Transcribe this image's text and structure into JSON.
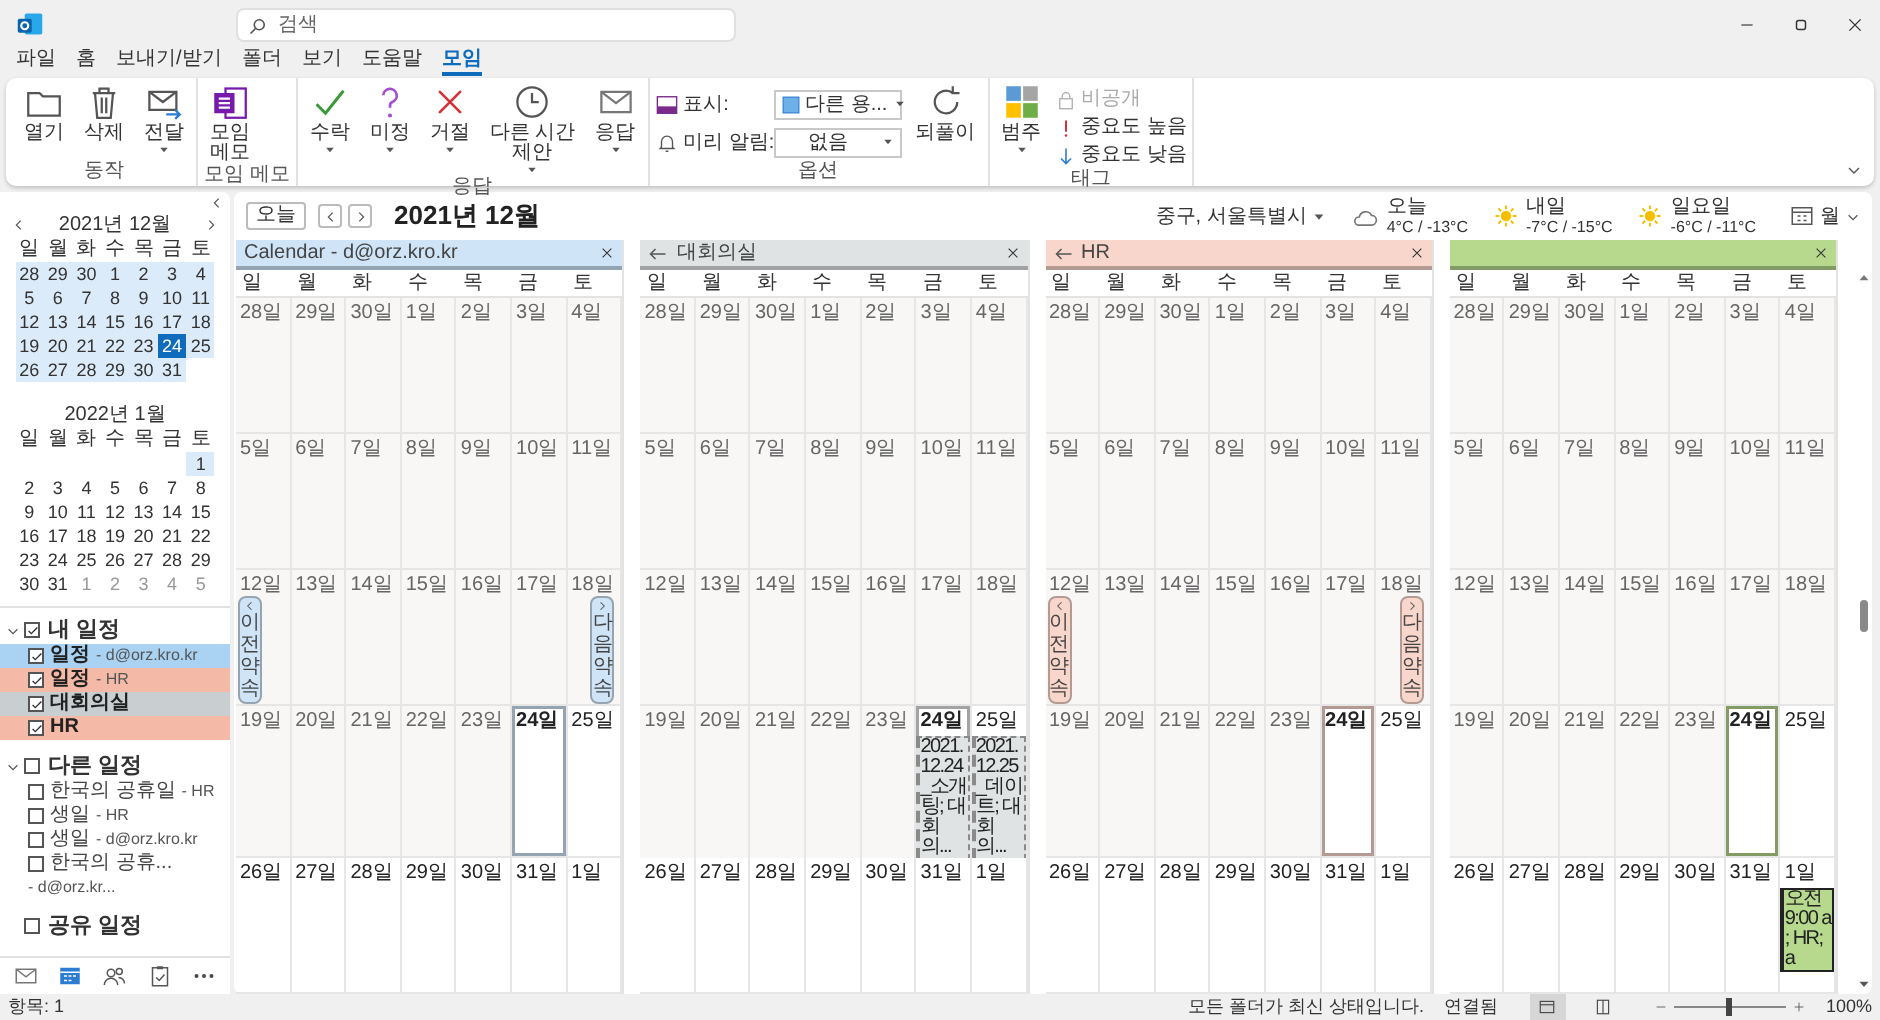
{
  "title_bar": {
    "search_placeholder": "검색"
  },
  "menu": [
    {
      "label": "파일",
      "selected": false
    },
    {
      "label": "홈",
      "selected": false
    },
    {
      "label": "보내기/받기",
      "selected": false
    },
    {
      "label": "폴더",
      "selected": false
    },
    {
      "label": "보기",
      "selected": false
    },
    {
      "label": "도움말",
      "selected": false
    },
    {
      "label": "모임",
      "selected": true
    }
  ],
  "ribbon": {
    "groups": [
      {
        "label": "동작",
        "items": [
          {
            "kind": "large",
            "label": "열기",
            "dropdown": false
          },
          {
            "kind": "large",
            "label": "삭제",
            "dropdown": false
          },
          {
            "kind": "large",
            "label": "전달",
            "dropdown": true
          }
        ]
      },
      {
        "label": "모임 메모",
        "items": [
          {
            "kind": "large",
            "label": "모임\n메모",
            "dropdown": false
          }
        ]
      },
      {
        "label": "응답",
        "items": [
          {
            "kind": "large",
            "label": "수락",
            "dropdown": true
          },
          {
            "kind": "large",
            "label": "미정",
            "dropdown": true
          },
          {
            "kind": "large",
            "label": "거절",
            "dropdown": true
          },
          {
            "kind": "large",
            "label": "다른 시간\n제안",
            "dropdown": true
          },
          {
            "kind": "large",
            "label": "응답",
            "dropdown": true
          }
        ]
      },
      {
        "label": "옵션",
        "items": [
          {
            "kind": "field",
            "label": "표시:",
            "value": "다른 용..."
          },
          {
            "kind": "field",
            "label": "미리 알림:",
            "value": "없음"
          },
          {
            "kind": "large",
            "label": "되풀이",
            "dropdown": false
          }
        ]
      },
      {
        "label": "태그",
        "items": [
          {
            "kind": "large",
            "label": "범주",
            "dropdown": true,
            "disabled": false
          },
          {
            "kind": "small",
            "label": "비공개",
            "disabled": true
          },
          {
            "kind": "small",
            "label": "중요도 높음",
            "disabled": false
          },
          {
            "kind": "small",
            "label": "중요도 낮음",
            "disabled": false
          }
        ]
      }
    ]
  },
  "mini_calendars": [
    {
      "title": "2021년 12월",
      "nav": true,
      "weekdays": [
        "일",
        "월",
        "화",
        "수",
        "목",
        "금",
        "토"
      ],
      "weeks": [
        [
          {
            "label": "28",
            "in_view": true,
            "selected": false,
            "dim": false
          },
          {
            "label": "29",
            "in_view": true,
            "selected": false,
            "dim": false
          },
          {
            "label": "30",
            "in_view": true,
            "selected": false,
            "dim": false
          },
          {
            "label": "1",
            "in_view": true,
            "selected": false,
            "dim": false
          },
          {
            "label": "2",
            "in_view": true,
            "selected": false,
            "dim": false
          },
          {
            "label": "3",
            "in_view": true,
            "selected": false,
            "dim": false
          },
          {
            "label": "4",
            "in_view": true,
            "selected": false,
            "dim": false
          }
        ],
        [
          {
            "label": "5",
            "in_view": true,
            "selected": false,
            "dim": false
          },
          {
            "label": "6",
            "in_view": true,
            "selected": false,
            "dim": false
          },
          {
            "label": "7",
            "in_view": true,
            "selected": false,
            "dim": false
          },
          {
            "label": "8",
            "in_view": true,
            "selected": false,
            "dim": false
          },
          {
            "label": "9",
            "in_view": true,
            "selected": false,
            "dim": false
          },
          {
            "label": "10",
            "in_view": true,
            "selected": false,
            "dim": false
          },
          {
            "label": "11",
            "in_view": true,
            "selected": false,
            "dim": false
          }
        ],
        [
          {
            "label": "12",
            "in_view": true,
            "selected": false,
            "dim": false
          },
          {
            "label": "13",
            "in_view": true,
            "selected": false,
            "dim": false
          },
          {
            "label": "14",
            "in_view": true,
            "selected": false,
            "dim": false
          },
          {
            "label": "15",
            "in_view": true,
            "selected": false,
            "dim": false
          },
          {
            "label": "16",
            "in_view": true,
            "selected": false,
            "dim": false
          },
          {
            "label": "17",
            "in_view": true,
            "selected": false,
            "dim": false
          },
          {
            "label": "18",
            "in_view": true,
            "selected": false,
            "dim": false
          }
        ],
        [
          {
            "label": "19",
            "in_view": true,
            "selected": false,
            "dim": false
          },
          {
            "label": "20",
            "in_view": true,
            "selected": false,
            "dim": false
          },
          {
            "label": "21",
            "in_view": true,
            "selected": false,
            "dim": false
          },
          {
            "label": "22",
            "in_view": true,
            "selected": false,
            "dim": false
          },
          {
            "label": "23",
            "in_view": true,
            "selected": false,
            "dim": false
          },
          {
            "label": "24",
            "in_view": true,
            "selected": true,
            "dim": false
          },
          {
            "label": "25",
            "in_view": true,
            "selected": false,
            "dim": false
          }
        ],
        [
          {
            "label": "26",
            "in_view": true,
            "selected": false,
            "dim": false
          },
          {
            "label": "27",
            "in_view": true,
            "selected": false,
            "dim": false
          },
          {
            "label": "28",
            "in_view": true,
            "selected": false,
            "dim": false
          },
          {
            "label": "29",
            "in_view": true,
            "selected": false,
            "dim": false
          },
          {
            "label": "30",
            "in_view": true,
            "selected": false,
            "dim": false
          },
          {
            "label": "31",
            "in_view": true,
            "selected": false,
            "dim": false
          }
        ]
      ]
    },
    {
      "title": "2022년 1월",
      "nav": false,
      "weekdays": [
        "일",
        "월",
        "화",
        "수",
        "목",
        "금",
        "토"
      ],
      "weeks": [
        [
          {
            "label": "1",
            "in_view": true,
            "selected": false,
            "dim": false
          }
        ],
        [
          {
            "label": "2",
            "in_view": false,
            "selected": false,
            "dim": false
          },
          {
            "label": "3",
            "in_view": false,
            "selected": false,
            "dim": false
          },
          {
            "label": "4",
            "in_view": false,
            "selected": false,
            "dim": false
          },
          {
            "label": "5",
            "in_view": false,
            "selected": false,
            "dim": false
          },
          {
            "label": "6",
            "in_view": false,
            "selected": false,
            "dim": false
          },
          {
            "label": "7",
            "in_view": false,
            "selected": false,
            "dim": false
          },
          {
            "label": "8",
            "in_view": false,
            "selected": false,
            "dim": false
          }
        ],
        [
          {
            "label": "9",
            "in_view": false,
            "selected": false,
            "dim": false
          },
          {
            "label": "10",
            "in_view": false,
            "selected": false,
            "dim": false
          },
          {
            "label": "11",
            "in_view": false,
            "selected": false,
            "dim": false
          },
          {
            "label": "12",
            "in_view": false,
            "selected": false,
            "dim": false
          },
          {
            "label": "13",
            "in_view": false,
            "selected": false,
            "dim": false
          },
          {
            "label": "14",
            "in_view": false,
            "selected": false,
            "dim": false
          },
          {
            "label": "15",
            "in_view": false,
            "selected": false,
            "dim": false
          }
        ],
        [
          {
            "label": "16",
            "in_view": false,
            "selected": false,
            "dim": false
          },
          {
            "label": "17",
            "in_view": false,
            "selected": false,
            "dim": false
          },
          {
            "label": "18",
            "in_view": false,
            "selected": false,
            "dim": false
          },
          {
            "label": "19",
            "in_view": false,
            "selected": false,
            "dim": false
          },
          {
            "label": "20",
            "in_view": false,
            "selected": false,
            "dim": false
          },
          {
            "label": "21",
            "in_view": false,
            "selected": false,
            "dim": false
          },
          {
            "label": "22",
            "in_view": false,
            "selected": false,
            "dim": false
          }
        ],
        [
          {
            "label": "23",
            "in_view": false,
            "selected": false,
            "dim": false
          },
          {
            "label": "24",
            "in_view": false,
            "selected": false,
            "dim": false
          },
          {
            "label": "25",
            "in_view": false,
            "selected": false,
            "dim": false
          },
          {
            "label": "26",
            "in_view": false,
            "selected": false,
            "dim": false
          },
          {
            "label": "27",
            "in_view": false,
            "selected": false,
            "dim": false
          },
          {
            "label": "28",
            "in_view": false,
            "selected": false,
            "dim": false
          },
          {
            "label": "29",
            "in_view": false,
            "selected": false,
            "dim": false
          }
        ],
        [
          {
            "label": "30",
            "in_view": false,
            "selected": false,
            "dim": false
          },
          {
            "label": "31",
            "in_view": false,
            "selected": false,
            "dim": false
          },
          {
            "label": "1",
            "in_view": false,
            "selected": false,
            "dim": true
          },
          {
            "label": "2",
            "in_view": false,
            "selected": false,
            "dim": true
          },
          {
            "label": "3",
            "in_view": false,
            "selected": false,
            "dim": true
          },
          {
            "label": "4",
            "in_view": false,
            "selected": false,
            "dim": true
          },
          {
            "label": "5",
            "in_view": false,
            "selected": false,
            "dim": true
          }
        ]
      ]
    }
  ],
  "folders": [
    {
      "label": "내 일정",
      "expanded": true,
      "checked": true,
      "items": [
        {
          "name": "일정",
          "owner": "- d@orz.kro.kr",
          "checked": true,
          "color": "#a9d2f3"
        },
        {
          "name": "일정",
          "owner": "- HR",
          "checked": true,
          "color": "#f4b9a7"
        },
        {
          "name": "대회의실",
          "checked": true,
          "color": "#c9cfd1"
        },
        {
          "name": "HR",
          "checked": true,
          "color": "#f4b9a7"
        }
      ]
    },
    {
      "label": "다른 일정",
      "expanded": true,
      "checked": false,
      "items": [
        {
          "name": "한국의 공휴일",
          "owner": "- HR",
          "checked": false
        },
        {
          "name": "생일",
          "owner": "- HR",
          "checked": false
        },
        {
          "name": "생일",
          "owner": "- d@orz.kro.kr",
          "checked": false
        },
        {
          "name": "한국의 공휴...",
          "owner": "- d@orz.kr...",
          "checked": false
        }
      ]
    },
    {
      "label": "공유 일정",
      "expanded": false,
      "checked": false
    }
  ],
  "nav": [
    {
      "kind": "mail",
      "selected": false
    },
    {
      "kind": "calendar",
      "selected": true
    },
    {
      "kind": "people",
      "selected": false
    },
    {
      "kind": "tasks",
      "selected": false
    },
    {
      "kind": "more",
      "selected": false
    }
  ],
  "calendar_header": {
    "today_button": "오늘",
    "month_title": "2021년 12월",
    "location": "중구, 서울특별시",
    "weather": [
      {
        "day": "오늘",
        "temps": "4°C / -13°C",
        "kind": "cloud"
      },
      {
        "day": "내일",
        "temps": "-7°C / -15°C",
        "kind": "sun"
      },
      {
        "day": "일요일",
        "temps": "-6°C / -11°C",
        "kind": "sun"
      }
    ],
    "view": "월"
  },
  "panes": [
    {
      "title": "Calendar - d@orz.kro.kr",
      "back_arrow": false,
      "color": "#cfe4f7",
      "prev_tab": "이전 약속",
      "next_tab": "다음 약속",
      "weekdays": [
        "일",
        "월",
        "화",
        "수",
        "목",
        "금",
        "토"
      ],
      "weeks": [
        [
          {
            "label": "28일",
            "past": true,
            "today": false
          },
          {
            "label": "29일",
            "past": true,
            "today": false
          },
          {
            "label": "30일",
            "past": true,
            "today": false
          },
          {
            "label": "1일",
            "past": true,
            "today": false
          },
          {
            "label": "2일",
            "past": true,
            "today": false
          },
          {
            "label": "3일",
            "past": true,
            "today": false
          },
          {
            "label": "4일",
            "past": true,
            "today": false
          }
        ],
        [
          {
            "label": "5일",
            "past": true,
            "today": false
          },
          {
            "label": "6일",
            "past": true,
            "today": false
          },
          {
            "label": "7일",
            "past": true,
            "today": false
          },
          {
            "label": "8일",
            "past": true,
            "today": false
          },
          {
            "label": "9일",
            "past": true,
            "today": false
          },
          {
            "label": "10일",
            "past": true,
            "today": false
          },
          {
            "label": "11일",
            "past": true,
            "today": false
          }
        ],
        [
          {
            "label": "12일",
            "past": true,
            "today": false
          },
          {
            "label": "13일",
            "past": true,
            "today": false
          },
          {
            "label": "14일",
            "past": true,
            "today": false
          },
          {
            "label": "15일",
            "past": true,
            "today": false
          },
          {
            "label": "16일",
            "past": true,
            "today": false
          },
          {
            "label": "17일",
            "past": true,
            "today": false
          },
          {
            "label": "18일",
            "past": true,
            "today": false
          }
        ],
        [
          {
            "label": "19일",
            "past": true,
            "today": false
          },
          {
            "label": "20일",
            "past": true,
            "today": false
          },
          {
            "label": "21일",
            "past": true,
            "today": false
          },
          {
            "label": "22일",
            "past": true,
            "today": false
          },
          {
            "label": "23일",
            "past": true,
            "today": false
          },
          {
            "label": "24일",
            "past": false,
            "today": true
          },
          {
            "label": "25일",
            "past": false,
            "today": false
          }
        ],
        [
          {
            "label": "26일",
            "past": false,
            "today": false
          },
          {
            "label": "27일",
            "past": false,
            "today": false
          },
          {
            "label": "28일",
            "past": false,
            "today": false
          },
          {
            "label": "29일",
            "past": false,
            "today": false
          },
          {
            "label": "30일",
            "past": false,
            "today": false
          },
          {
            "label": "31일",
            "past": false,
            "today": false
          },
          {
            "label": "1일",
            "past": false,
            "today": false
          }
        ]
      ]
    },
    {
      "title": "대회의실",
      "back_arrow": true,
      "color": "#dfe3e4",
      "weekdays": [
        "일",
        "월",
        "화",
        "수",
        "목",
        "금",
        "토"
      ],
      "weeks": [
        [
          {
            "label": "28일",
            "past": true,
            "today": false
          },
          {
            "label": "29일",
            "past": true,
            "today": false
          },
          {
            "label": "30일",
            "past": true,
            "today": false
          },
          {
            "label": "1일",
            "past": true,
            "today": false
          },
          {
            "label": "2일",
            "past": true,
            "today": false
          },
          {
            "label": "3일",
            "past": true,
            "today": false
          },
          {
            "label": "4일",
            "past": true,
            "today": false
          }
        ],
        [
          {
            "label": "5일",
            "past": true,
            "today": false
          },
          {
            "label": "6일",
            "past": true,
            "today": false
          },
          {
            "label": "7일",
            "past": true,
            "today": false
          },
          {
            "label": "8일",
            "past": true,
            "today": false
          },
          {
            "label": "9일",
            "past": true,
            "today": false
          },
          {
            "label": "10일",
            "past": true,
            "today": false
          },
          {
            "label": "11일",
            "past": true,
            "today": false
          }
        ],
        [
          {
            "label": "12일",
            "past": true,
            "today": false
          },
          {
            "label": "13일",
            "past": true,
            "today": false
          },
          {
            "label": "14일",
            "past": true,
            "today": false
          },
          {
            "label": "15일",
            "past": true,
            "today": false
          },
          {
            "label": "16일",
            "past": true,
            "today": false
          },
          {
            "label": "17일",
            "past": true,
            "today": false
          },
          {
            "label": "18일",
            "past": true,
            "today": false
          }
        ],
        [
          {
            "label": "19일",
            "past": true,
            "today": false
          },
          {
            "label": "20일",
            "past": true,
            "today": false
          },
          {
            "label": "21일",
            "past": true,
            "today": false
          },
          {
            "label": "22일",
            "past": true,
            "today": false
          },
          {
            "label": "23일",
            "past": true,
            "today": false
          },
          {
            "label": "24일",
            "past": false,
            "today": true,
            "events": [
              {
                "text": "2021.12.24_소개팅; 대회의...",
                "tentative": true
              }
            ]
          },
          {
            "label": "25일",
            "past": false,
            "today": false,
            "events": [
              {
                "text": "2021.12.25_데이트; 대회의...",
                "tentative": true
              }
            ]
          }
        ],
        [
          {
            "label": "26일",
            "past": false,
            "today": false
          },
          {
            "label": "27일",
            "past": false,
            "today": false
          },
          {
            "label": "28일",
            "past": false,
            "today": false
          },
          {
            "label": "29일",
            "past": false,
            "today": false
          },
          {
            "label": "30일",
            "past": false,
            "today": false
          },
          {
            "label": "31일",
            "past": false,
            "today": false
          },
          {
            "label": "1일",
            "past": false,
            "today": false
          }
        ]
      ]
    },
    {
      "title": "HR",
      "back_arrow": true,
      "color": "#f9d6cb",
      "prev_tab": "이전 약속",
      "next_tab": "다음 약속",
      "weekdays": [
        "일",
        "월",
        "화",
        "수",
        "목",
        "금",
        "토"
      ],
      "weeks": [
        [
          {
            "label": "28일",
            "past": true,
            "today": false
          },
          {
            "label": "29일",
            "past": true,
            "today": false
          },
          {
            "label": "30일",
            "past": true,
            "today": false
          },
          {
            "label": "1일",
            "past": true,
            "today": false
          },
          {
            "label": "2일",
            "past": true,
            "today": false
          },
          {
            "label": "3일",
            "past": true,
            "today": false
          },
          {
            "label": "4일",
            "past": true,
            "today": false
          }
        ],
        [
          {
            "label": "5일",
            "past": true,
            "today": false
          },
          {
            "label": "6일",
            "past": true,
            "today": false
          },
          {
            "label": "7일",
            "past": true,
            "today": false
          },
          {
            "label": "8일",
            "past": true,
            "today": false
          },
          {
            "label": "9일",
            "past": true,
            "today": false
          },
          {
            "label": "10일",
            "past": true,
            "today": false
          },
          {
            "label": "11일",
            "past": true,
            "today": false
          }
        ],
        [
          {
            "label": "12일",
            "past": true,
            "today": false
          },
          {
            "label": "13일",
            "past": true,
            "today": false
          },
          {
            "label": "14일",
            "past": true,
            "today": false
          },
          {
            "label": "15일",
            "past": true,
            "today": false
          },
          {
            "label": "16일",
            "past": true,
            "today": false
          },
          {
            "label": "17일",
            "past": true,
            "today": false
          },
          {
            "label": "18일",
            "past": true,
            "today": false
          }
        ],
        [
          {
            "label": "19일",
            "past": true,
            "today": false
          },
          {
            "label": "20일",
            "past": true,
            "today": false
          },
          {
            "label": "21일",
            "past": true,
            "today": false
          },
          {
            "label": "22일",
            "past": true,
            "today": false
          },
          {
            "label": "23일",
            "past": true,
            "today": false
          },
          {
            "label": "24일",
            "past": false,
            "today": true
          },
          {
            "label": "25일",
            "past": false,
            "today": false
          }
        ],
        [
          {
            "label": "26일",
            "past": false,
            "today": false
          },
          {
            "label": "27일",
            "past": false,
            "today": false
          },
          {
            "label": "28일",
            "past": false,
            "today": false
          },
          {
            "label": "29일",
            "past": false,
            "today": false
          },
          {
            "label": "30일",
            "past": false,
            "today": false
          },
          {
            "label": "31일",
            "past": false,
            "today": false
          },
          {
            "label": "1일",
            "past": false,
            "today": false
          }
        ]
      ]
    },
    {
      "back_arrow": false,
      "color": "#b6d98e",
      "weekdays": [
        "일",
        "월",
        "화",
        "수",
        "목",
        "금",
        "토"
      ],
      "weeks": [
        [
          {
            "label": "28일",
            "past": true,
            "today": false
          },
          {
            "label": "29일",
            "past": true,
            "today": false
          },
          {
            "label": "30일",
            "past": true,
            "today": false
          },
          {
            "label": "1일",
            "past": true,
            "today": false
          },
          {
            "label": "2일",
            "past": true,
            "today": false
          },
          {
            "label": "3일",
            "past": true,
            "today": false
          },
          {
            "label": "4일",
            "past": true,
            "today": false
          }
        ],
        [
          {
            "label": "5일",
            "past": true,
            "today": false
          },
          {
            "label": "6일",
            "past": true,
            "today": false
          },
          {
            "label": "7일",
            "past": true,
            "today": false
          },
          {
            "label": "8일",
            "past": true,
            "today": false
          },
          {
            "label": "9일",
            "past": true,
            "today": false
          },
          {
            "label": "10일",
            "past": true,
            "today": false
          },
          {
            "label": "11일",
            "past": true,
            "today": false
          }
        ],
        [
          {
            "label": "12일",
            "past": true,
            "today": false
          },
          {
            "label": "13일",
            "past": true,
            "today": false
          },
          {
            "label": "14일",
            "past": true,
            "today": false
          },
          {
            "label": "15일",
            "past": true,
            "today": false
          },
          {
            "label": "16일",
            "past": true,
            "today": false
          },
          {
            "label": "17일",
            "past": true,
            "today": false
          },
          {
            "label": "18일",
            "past": true,
            "today": false
          }
        ],
        [
          {
            "label": "19일",
            "past": true,
            "today": false
          },
          {
            "label": "20일",
            "past": true,
            "today": false
          },
          {
            "label": "21일",
            "past": true,
            "today": false
          },
          {
            "label": "22일",
            "past": true,
            "today": false
          },
          {
            "label": "23일",
            "past": true,
            "today": false
          },
          {
            "label": "24일",
            "past": false,
            "today": true
          },
          {
            "label": "25일",
            "past": false,
            "today": false
          }
        ],
        [
          {
            "label": "26일",
            "past": false,
            "today": false
          },
          {
            "label": "27일",
            "past": false,
            "today": false
          },
          {
            "label": "28일",
            "past": false,
            "today": false
          },
          {
            "label": "29일",
            "past": false,
            "today": false
          },
          {
            "label": "30일",
            "past": false,
            "today": false
          },
          {
            "label": "31일",
            "past": false,
            "today": false
          },
          {
            "label": "1일",
            "past": false,
            "today": false,
            "events": [
              {
                "text": "오전 9:00 a ; HR; a",
                "tentative": false
              }
            ]
          }
        ]
      ]
    }
  ],
  "status_bar": {
    "items": "항목: 1",
    "sync": "모든 폴더가 최신 상태입니다.",
    "connection": "연결됨",
    "views": [
      {
        "selected": true
      },
      {
        "selected": false
      }
    ],
    "zoom": {
      "level": 0.5
    },
    "zoom_label": "100%"
  }
}
